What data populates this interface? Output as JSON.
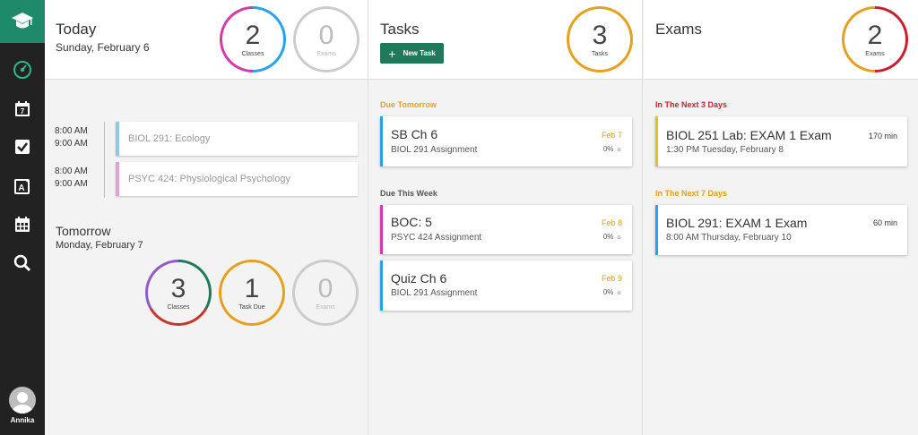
{
  "user": {
    "name": "Annika"
  },
  "sidebar": {
    "icons": [
      "graduation-cap-icon",
      "dashboard-icon",
      "calendar-day-icon",
      "checkbox-icon",
      "exam-icon",
      "calendar-grid-icon",
      "search-icon"
    ]
  },
  "today": {
    "title": "Today",
    "date": "Sunday, February 6",
    "classes": {
      "value": "2",
      "label": "Classes"
    },
    "exams": {
      "value": "0",
      "label": "Exams"
    },
    "schedule": [
      {
        "start": "8:00 AM",
        "end": "9:00 AM",
        "name": "BIOL 291: Ecology",
        "color": "#8cc8ec"
      },
      {
        "start": "8:00 AM",
        "end": "9:00 AM",
        "name": "PSYC 424: Physiological Psychology",
        "color": "#e0a0d8"
      }
    ]
  },
  "tomorrow": {
    "title": "Tomorrow",
    "date": "Monday, February 7",
    "classes": {
      "value": "3",
      "label": "Classes"
    },
    "tasks": {
      "value": "1",
      "label": "Task Due"
    },
    "exams": {
      "value": "0",
      "label": "Exams"
    }
  },
  "tasks": {
    "title": "Tasks",
    "new_label": "New Task",
    "count": {
      "value": "3",
      "label": "Tasks"
    },
    "sections": [
      {
        "label": "Due Tomorrow",
        "color": "#e6a020",
        "items": [
          {
            "title": "SB Ch 6",
            "sub": "BIOL 291 Assignment",
            "due": "Feb 7",
            "progress": "0%",
            "color": "#2aa2ea"
          }
        ]
      },
      {
        "label": "Due This Week",
        "color": "#555555",
        "items": [
          {
            "title": "BOC: 5",
            "sub": "PSYC 424 Assignment",
            "due": "Feb 8",
            "progress": "0%",
            "color": "#d43ba8"
          },
          {
            "title": "Quiz Ch 6",
            "sub": "BIOL 291 Assignment",
            "due": "Feb 9",
            "progress": "0%",
            "color": "#2aa2ea"
          }
        ]
      }
    ]
  },
  "exams": {
    "title": "Exams",
    "count": {
      "value": "2",
      "label": "Exams"
    },
    "sections": [
      {
        "label": "In The Next 3 Days",
        "color": "#c8202e",
        "items": [
          {
            "title": "BIOL 251 Lab: EXAM 1 Exam",
            "sub": "1:30 PM Tuesday, February 8",
            "duration": "170 min",
            "color": "#e6c020"
          }
        ]
      },
      {
        "label": "In The Next 7 Days",
        "color": "#e6a020",
        "items": [
          {
            "title": "BIOL 291: EXAM 1 Exam",
            "sub": "8:00 AM Thursday, February 10",
            "duration": "60 min",
            "color": "#2aa2ea"
          }
        ]
      }
    ]
  },
  "colors": {
    "accent": "#1e8a6a",
    "sidebar": "#222222"
  }
}
